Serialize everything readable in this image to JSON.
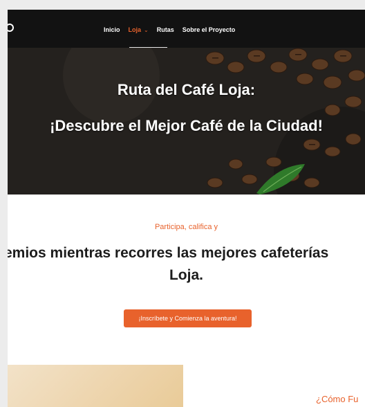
{
  "nav": {
    "items": [
      {
        "label": "Inicio"
      },
      {
        "label": "Loja"
      },
      {
        "label": "Rutas"
      },
      {
        "label": "Sobre el Proyecto"
      }
    ],
    "active_index": 1
  },
  "hero": {
    "title_line1": "Ruta del Café Loja:",
    "title_line2": "¡Descubre el Mejor Café de la Ciudad!"
  },
  "intro": {
    "tagline": "Participa, califica y",
    "headline_line1": "emios mientras recorres las mejores cafeterías",
    "headline_line2": "Loja.",
    "cta_label": "¡Inscríbete y Comienza la aventura!"
  },
  "how": {
    "heading": "¿Cómo Fu"
  },
  "colors": {
    "accent": "#e8622c",
    "nav_bg": "#121212"
  }
}
